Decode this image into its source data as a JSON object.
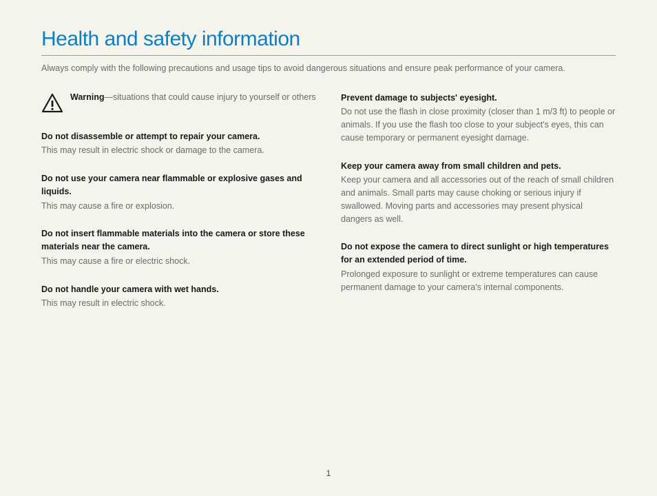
{
  "title": "Health and safety information",
  "intro": "Always comply with the following precautions and usage tips to avoid dangerous situations and ensure peak performance of your camera.",
  "warning_label": "Warning",
  "warning_desc": "—situations that could cause injury to yourself or others",
  "left_sections": [
    {
      "title": "Do not disassemble or attempt to repair your camera.",
      "body": "This may result in electric shock or damage to the camera."
    },
    {
      "title": "Do not use your camera near flammable or explosive gases and liquids.",
      "body": "This may cause a fire or explosion."
    },
    {
      "title": "Do not insert flammable materials into the camera or store these materials near the camera.",
      "body": "This may cause a fire or electric shock."
    },
    {
      "title": "Do not handle your camera with wet hands.",
      "body": "This may result in electric shock."
    }
  ],
  "right_sections": [
    {
      "title": "Prevent damage to subjects' eyesight.",
      "body": "Do not use the flash in close proximity (closer than 1 m/3 ft) to people or animals. If you use the flash too close to your subject's eyes, this can cause temporary or permanent eyesight damage."
    },
    {
      "title": "Keep your camera away from small children and pets.",
      "body": "Keep your camera and all accessories out of the reach of small children and animals. Small parts may cause choking or serious injury if swallowed. Moving parts and accessories may present physical dangers as well."
    },
    {
      "title": "Do not expose the camera to direct sunlight or high temperatures for an extended period of time.",
      "body": "Prolonged exposure to sunlight or extreme temperatures can cause permanent damage to your camera's internal components."
    }
  ],
  "page_number": "1"
}
